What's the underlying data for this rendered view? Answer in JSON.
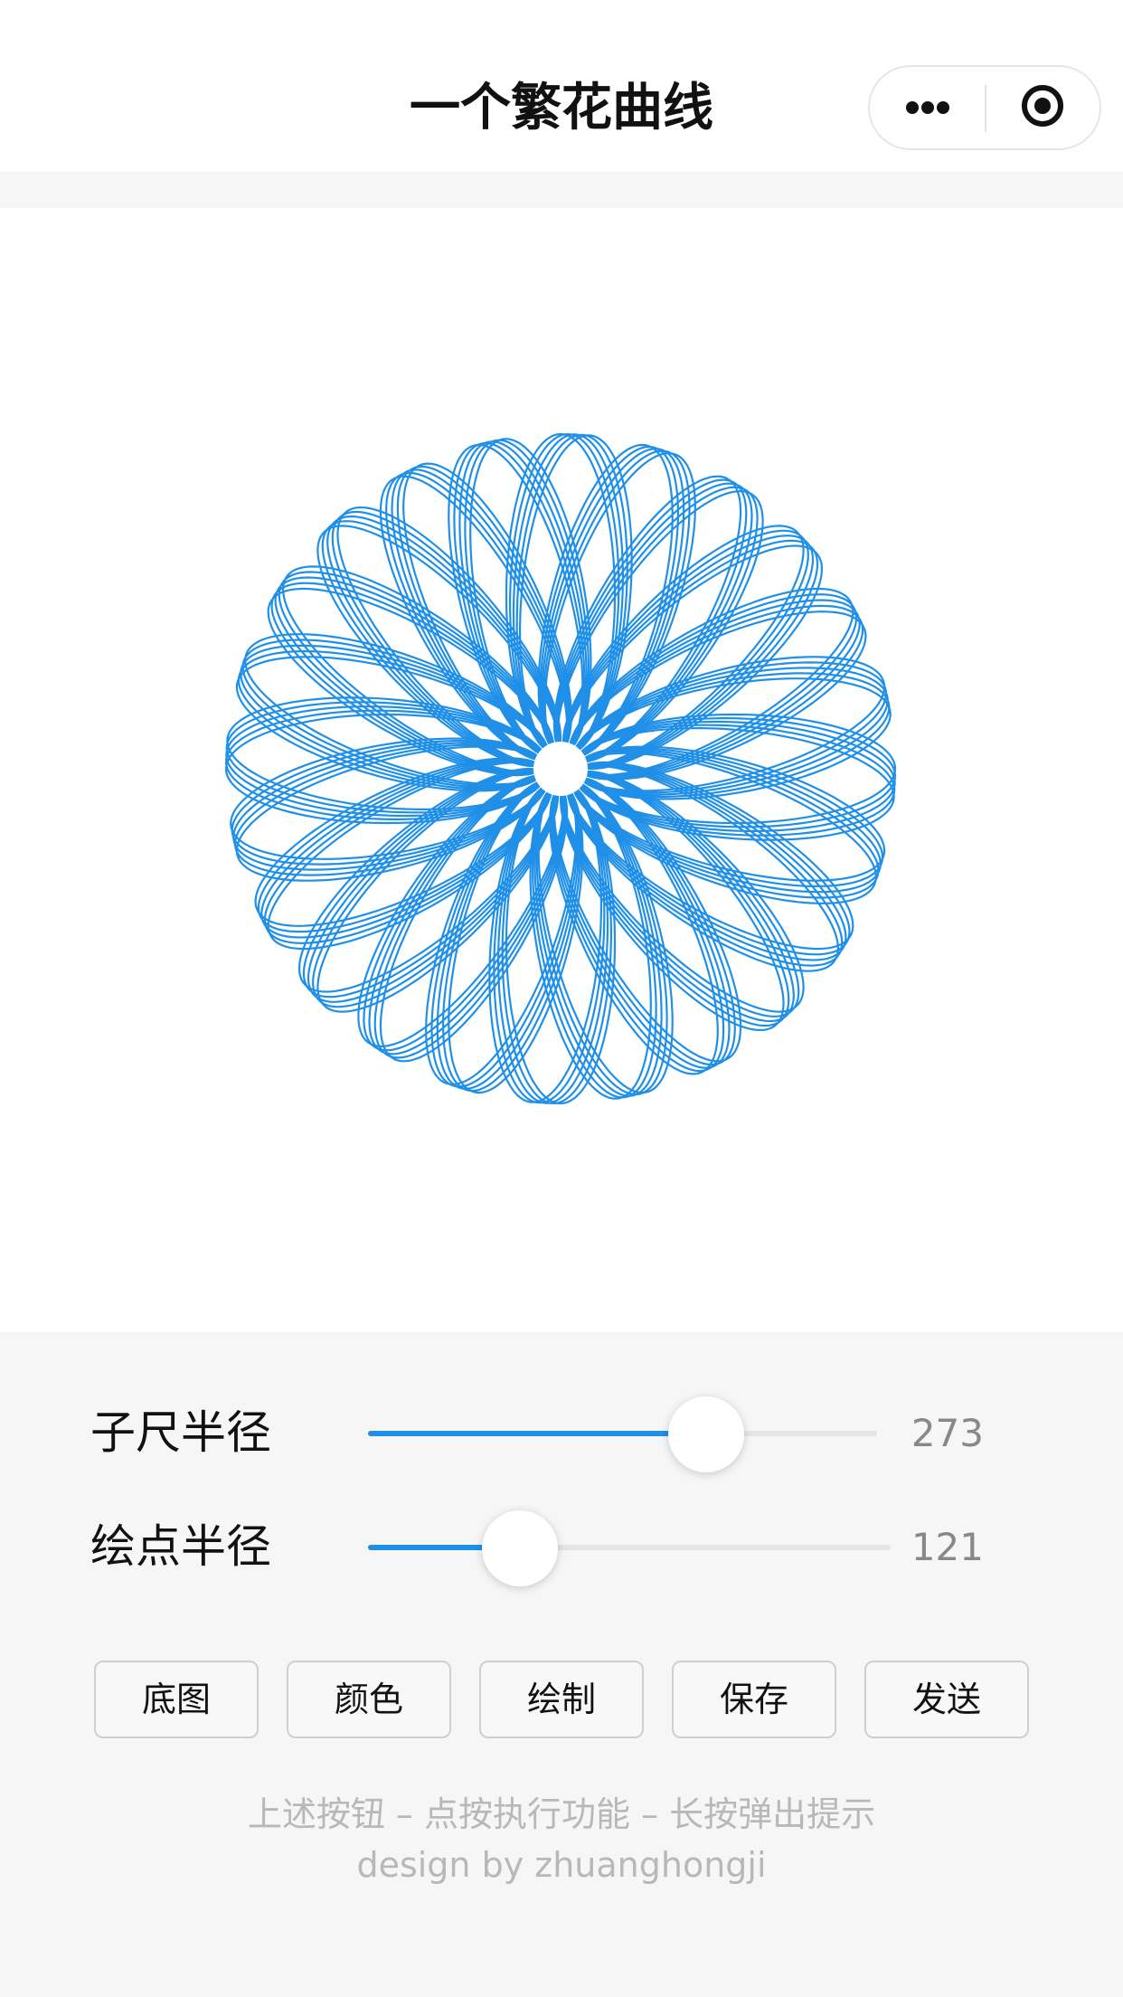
{
  "navbar": {
    "title": "一个繁花曲线",
    "more_icon": "more-dots-icon",
    "close_icon": "target-circle-icon"
  },
  "canvas": {
    "curve_color": "#1f8fe8",
    "background": "#ffffff"
  },
  "sliders": [
    {
      "label": "子尺半径",
      "value": "273",
      "fraction": 0.665
    },
    {
      "label": "绘点半径",
      "value": "121",
      "fraction": 0.29
    }
  ],
  "buttons": [
    {
      "label": "底图"
    },
    {
      "label": "颜色"
    },
    {
      "label": "绘制"
    },
    {
      "label": "保存"
    },
    {
      "label": "发送"
    }
  ],
  "footer": {
    "hint": "上述按钮 – 点按执行功能 – 长按弹出提示",
    "credit": "design by zhuanghongji"
  },
  "colors": {
    "accent": "#1f8fe8",
    "panel_background": "#f6f6f6",
    "hint_text": "#b8b8b8"
  }
}
